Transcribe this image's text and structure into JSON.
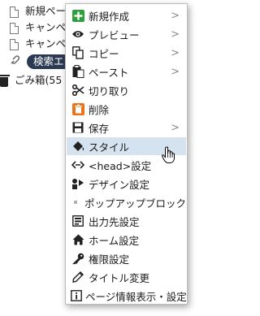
{
  "tree": {
    "rows": [
      {
        "label": "新規ページ",
        "icon": "document-icon"
      },
      {
        "label": "キャンペ",
        "icon": "document-icon"
      },
      {
        "label": "キャンペ",
        "icon": "document-icon"
      },
      {
        "label": "検索エ",
        "icon": "link-icon",
        "selected": true
      },
      {
        "label": "ごみ箱(55",
        "icon": "trash-icon"
      }
    ]
  },
  "menu": {
    "items": [
      {
        "label": "新規作成",
        "icon": "plus-icon",
        "submenu": true
      },
      {
        "label": "プレビュー",
        "icon": "eye-icon",
        "submenu": true
      },
      {
        "label": "コピー",
        "icon": "copy-icon",
        "submenu": true
      },
      {
        "label": "ペースト",
        "icon": "paste-icon",
        "submenu": true
      },
      {
        "label": "切り取り",
        "icon": "scissors-icon",
        "submenu": false
      },
      {
        "label": "削除",
        "icon": "delete-icon",
        "submenu": false
      },
      {
        "label": "保存",
        "icon": "save-icon",
        "submenu": true
      },
      {
        "label": "スタイル",
        "icon": "paint-bucket-icon",
        "submenu": false,
        "hovered": true
      },
      {
        "label": "<head>設定",
        "icon": "code-arrows-icon",
        "submenu": false
      },
      {
        "label": "デザイン設定",
        "icon": "design-icon",
        "submenu": false
      },
      {
        "label": "ポップアップブロック",
        "icon": "dot-icon",
        "submenu": false
      },
      {
        "label": "出力先設定",
        "icon": "output-icon",
        "submenu": false
      },
      {
        "label": "ホーム設定",
        "icon": "home-icon",
        "submenu": false
      },
      {
        "label": "権限設定",
        "icon": "key-icon",
        "submenu": false
      },
      {
        "label": "タイトル変更",
        "icon": "pencil-icon",
        "submenu": false
      },
      {
        "label": "ページ情報表示・設定",
        "icon": "info-icon",
        "submenu": false
      }
    ],
    "submenu_arrow": ">"
  },
  "colors": {
    "hover_bg": "#d5e3f0",
    "plus_green": "#2e9e3e",
    "delete_orange": "#e8731a",
    "selected_pill": "#2b3a52"
  }
}
